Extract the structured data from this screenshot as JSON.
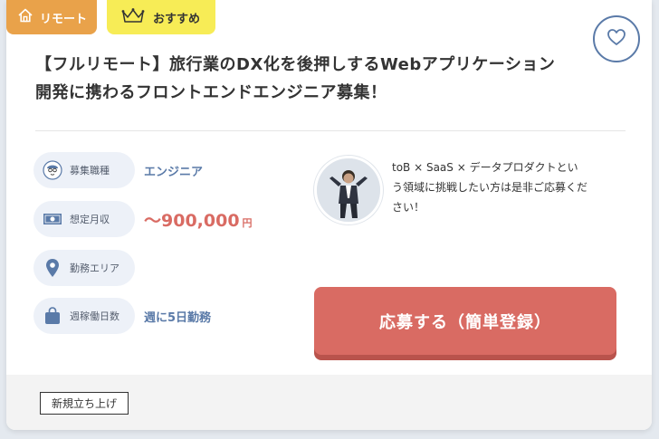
{
  "tags": {
    "remote_label": "リモート",
    "remote_icon": "home-icon",
    "recommend_label": "おすすめ",
    "recommend_icon": "crown-icon"
  },
  "favorite": {
    "icon": "heart-icon"
  },
  "title": {
    "line1": "【フルリモート】旅行業のDX化を後押しするWebアプリケーション",
    "line2": "開発に携わるフロントエンドエンジニア募集！"
  },
  "info": {
    "job_type": {
      "label": "募集職種",
      "value": "エンジニア",
      "icon": "person-icon"
    },
    "salary": {
      "label": "想定月収",
      "value": "〜900,000",
      "unit": "円",
      "icon": "money-icon"
    },
    "location": {
      "label": "勤務エリア",
      "value": "",
      "icon": "pin-icon"
    },
    "workdays": {
      "label": "週稼働日数",
      "value": "週に5日勤務",
      "icon": "bag-icon"
    }
  },
  "message": {
    "line1": "toB × SaaS × データプロダクトとい",
    "line2": "う領域に挑戦したい方は是非ご応募くだ",
    "line3": "さい！"
  },
  "apply": {
    "label": "応募する（簡単登録）"
  },
  "footer": {
    "tag_label": "新規立ち上げ"
  },
  "colors": {
    "remote_tag": "#e9a24a",
    "recommend_tag": "#f7ec56",
    "accent_blue": "#5a7aa8",
    "accent_red": "#d96b63"
  }
}
